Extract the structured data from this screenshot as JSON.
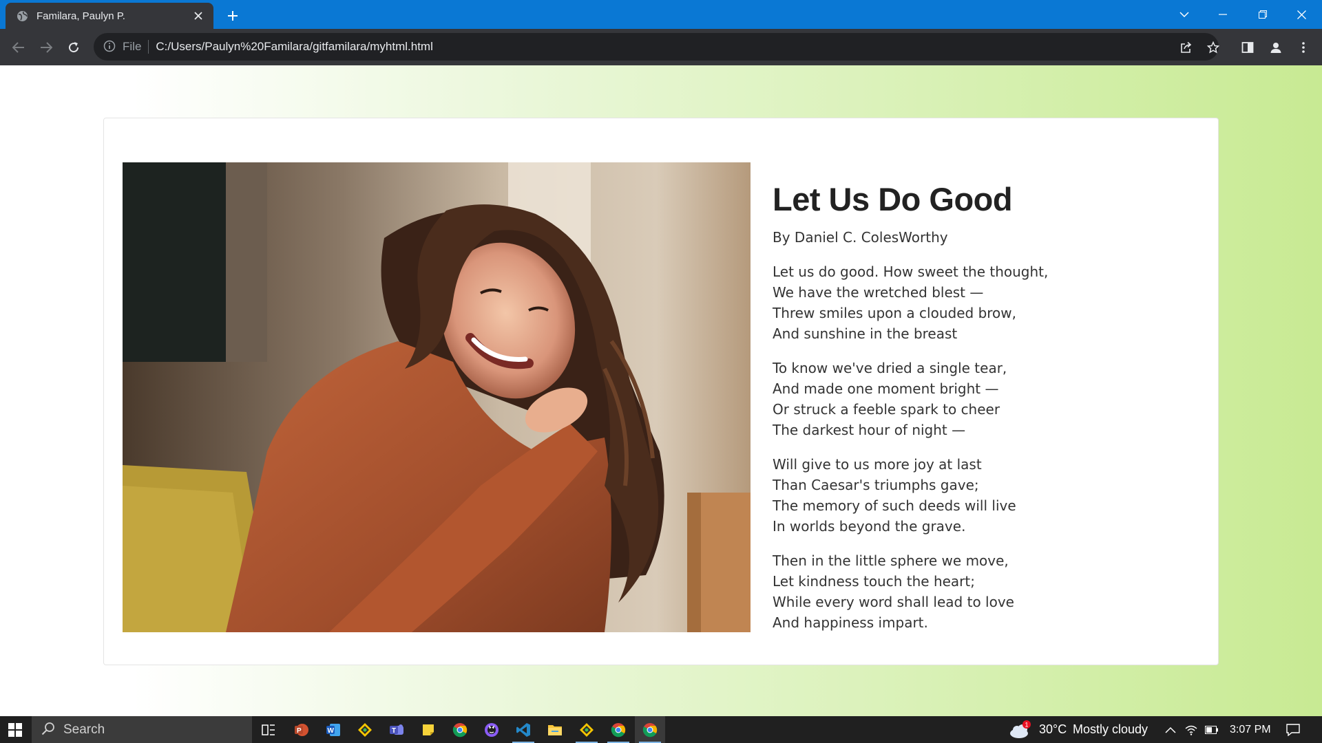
{
  "browser": {
    "tab": {
      "title": "Familara, Paulyn P."
    },
    "address": {
      "scheme": "File",
      "url": "C:/Users/Paulyn%20Familara/gitfamilara/myhtml.html"
    }
  },
  "page": {
    "photo": {
      "alt_subject": "smiling woman with curly hair in rust sweater"
    },
    "poem": {
      "title": "Let Us Do Good",
      "author": "By Daniel C. ColesWorthy",
      "stanzas": [
        [
          "Let us do good. How sweet the thought,",
          "We have the wretched blest —",
          "Threw smiles upon a clouded brow,",
          "And sunshine in the breast"
        ],
        [
          "To know we've dried a single tear,",
          "And made one moment bright —",
          "Or struck a feeble spark to cheer",
          "The darkest hour of night —"
        ],
        [
          "Will give to us more joy at last",
          "Than Caesar's triumphs gave;",
          "The memory of such deeds will live",
          "In worlds beyond the grave."
        ],
        [
          "Then in the little sphere we move,",
          "Let kindness touch the heart;",
          "While every word shall lead to love",
          "And happiness impart."
        ]
      ]
    }
  },
  "taskbar": {
    "search_label": "Search",
    "weather": {
      "temp": "30°C",
      "condition": "Mostly cloudy",
      "badge": "1"
    },
    "clock": "3:07 PM"
  },
  "colors": {
    "titlebar": "#0a78d4",
    "tab": "#35363a",
    "gradient_end": "#c8ea93"
  }
}
